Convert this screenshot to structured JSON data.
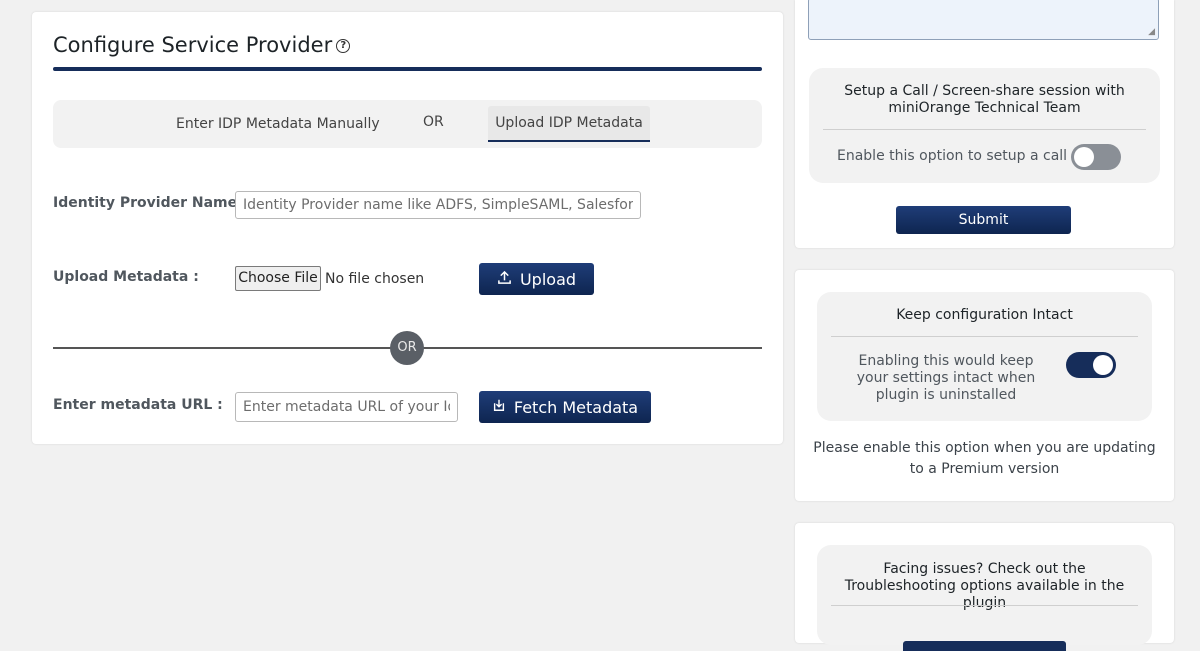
{
  "configure": {
    "title": "Configure Service Provider",
    "help_glyph": "?",
    "tabs": {
      "manual": "Enter IDP Metadata Manually",
      "or": "OR",
      "upload": "Upload IDP Metadata"
    },
    "idp_name": {
      "label": "Identity Provider Name :",
      "placeholder": "Identity Provider name like ADFS, SimpleSAML, Salesforce",
      "value": ""
    },
    "upload_metadata": {
      "label": "Upload Metadata :",
      "choose_label": "Choose File",
      "file_status": "No file chosen",
      "upload_label": "Upload"
    },
    "separator_or": "OR",
    "metadata_url": {
      "label": "Enter metadata URL :",
      "placeholder": "Enter metadata URL of your IdP",
      "value": "",
      "fetch_label": "Fetch Metadata"
    }
  },
  "support": {
    "call_title": "Setup a Call / Screen-share session with miniOrange Technical Team",
    "call_option_label": "Enable this option to setup a call",
    "call_toggle_on": false,
    "submit_label": "Submit"
  },
  "keep_config": {
    "title": "Keep configuration Intact",
    "description": "Enabling this would keep your settings intact when plugin is uninstalled",
    "toggle_on": true,
    "note": "Please enable this option when you are updating to a Premium version"
  },
  "troubleshoot": {
    "title": "Facing issues? Check out the Troubleshooting options available in the plugin"
  },
  "colors": {
    "accent": "#162d5a",
    "toggle_off": "#8a8f96",
    "page_bg": "#f1f1f1"
  }
}
